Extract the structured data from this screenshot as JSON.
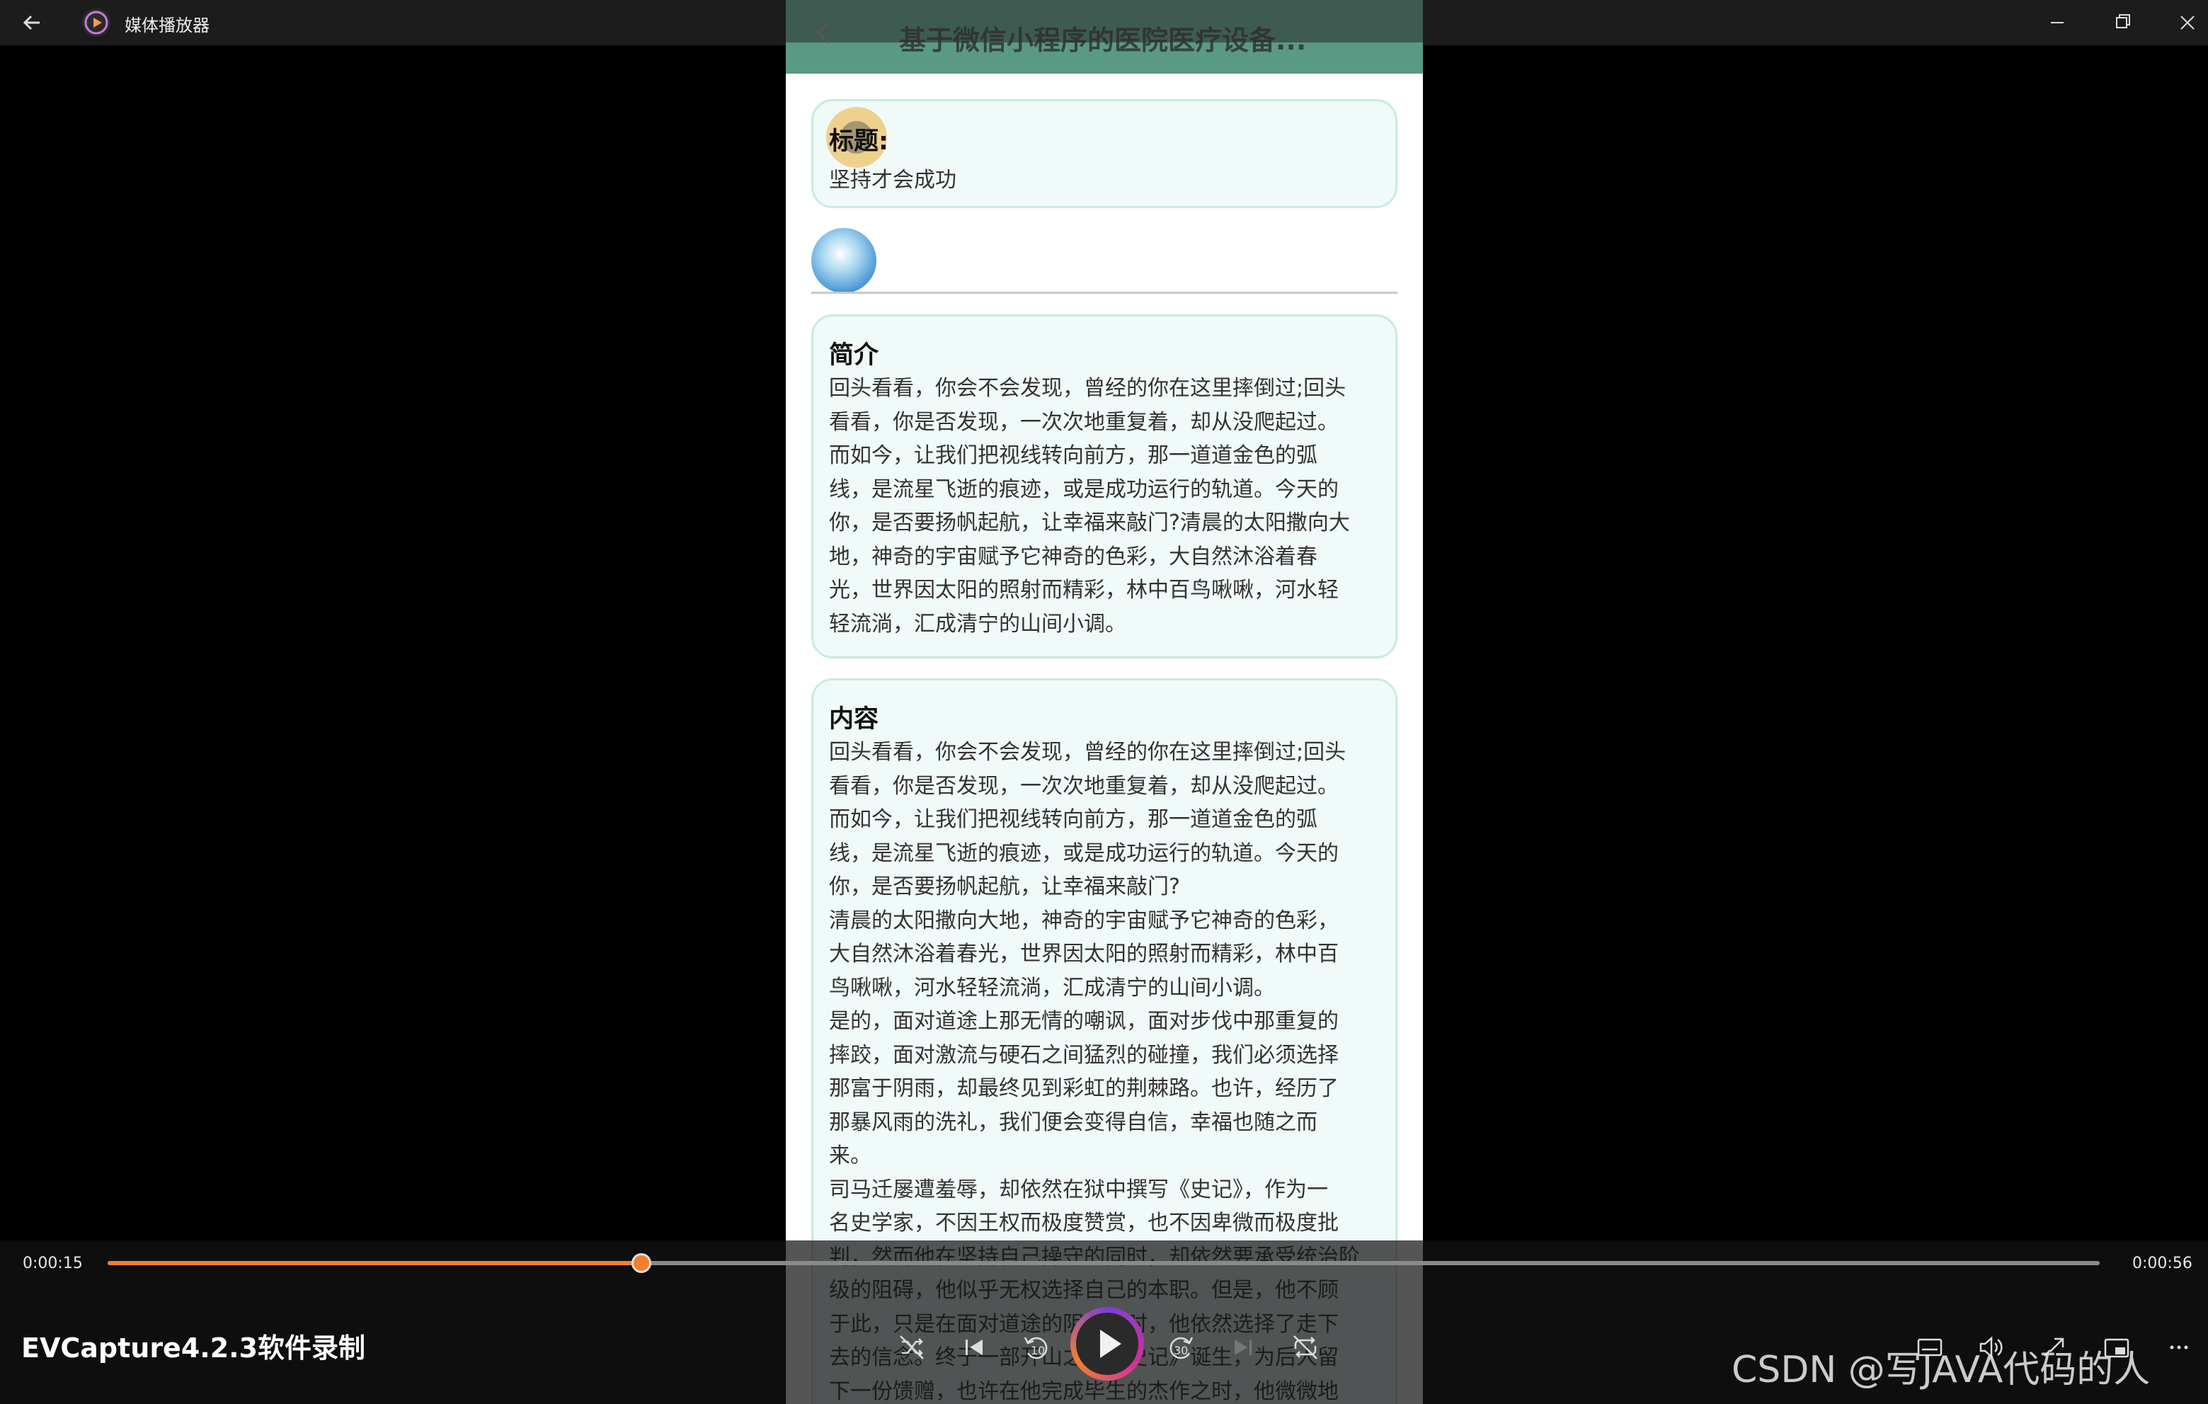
{
  "window": {
    "app_title": "媒体播放器",
    "icons": {
      "back": "back-arrow-icon",
      "app": "media-player-icon",
      "minimize": "minimize-icon",
      "maximize": "restore-icon",
      "close": "close-icon"
    }
  },
  "phone": {
    "header_title": "基于微信小程序的医院医疗设备...",
    "title_card": {
      "label": "标题:",
      "value": "坚持才会成功"
    },
    "intro_card": {
      "heading": "简介",
      "text": "回头看看，你会不会发现，曾经的你在这里摔倒过;回头\n看看，你是否发现，一次次地重复着，却从没爬起过。\n而如今，让我们把视线转向前方，那一道道金色的弧\n线，是流星飞逝的痕迹，或是成功运行的轨道。今天的\n你，是否要扬帆起航，让幸福来敲门?清晨的太阳撒向大\n地，神奇的宇宙赋予它神奇的色彩，大自然沐浴着春\n光，世界因太阳的照射而精彩，林中百鸟啾啾，河水轻\n轻流淌，汇成清宁的山间小调。"
    },
    "content_card": {
      "heading": "内容",
      "text": "回头看看，你会不会发现，曾经的你在这里摔倒过;回头\n看看，你是否发现，一次次地重复着，却从没爬起过。\n而如今，让我们把视线转向前方，那一道道金色的弧\n线，是流星飞逝的痕迹，或是成功运行的轨道。今天的\n你，是否要扬帆起航，让幸福来敲门?\n清晨的太阳撒向大地，神奇的宇宙赋予它神奇的色彩，\n大自然沐浴着春光，世界因太阳的照射而精彩，林中百\n鸟啾啾，河水轻轻流淌，汇成清宁的山间小调。\n是的，面对道途上那无情的嘲讽，面对步伐中那重复的\n摔跤，面对激流与硬石之间猛烈的碰撞，我们必须选择\n那富于阴雨，却最终见到彩虹的荆棘路。也许，经历了\n那暴风雨的洗礼，我们便会变得自信，幸福也随之而\n来。\n司马迁屡遭羞辱，却依然在狱中撰写《史记》，作为一\n名史学家，不因王权而极度赞赏，也不因卑微而极度批\n判，然而他在坚持自己操守的同时，却依然要承受统治阶\n级的阻碍，他似乎无权选择自己的本职。但是，他不顾\n于此，只是在面对道途的阴暗之时，他依然选择了走下\n去的信念。终于一部开山之作《史记》诞生，为后人留\n下一份馈赠，也许在他完成毕生的杰作之时，他微微地"
    }
  },
  "player": {
    "current_time": "0:00:15",
    "total_time": "0:00:56",
    "progress_fraction": 0.268,
    "file_name": "EVCapture4.2.3软件录制",
    "controls": [
      "shuffle-icon",
      "previous-icon",
      "rewind-10-icon",
      "play-icon",
      "forward-30-icon",
      "next-icon",
      "repeat-off-icon",
      "subtitles-icon",
      "volume-icon",
      "cast-icon",
      "mini-view-icon",
      "more-icon"
    ],
    "rewind_label": "10",
    "forward_label": "30",
    "accent_color": "#f08030"
  },
  "watermark": "CSDN @写JAVA代码的人"
}
